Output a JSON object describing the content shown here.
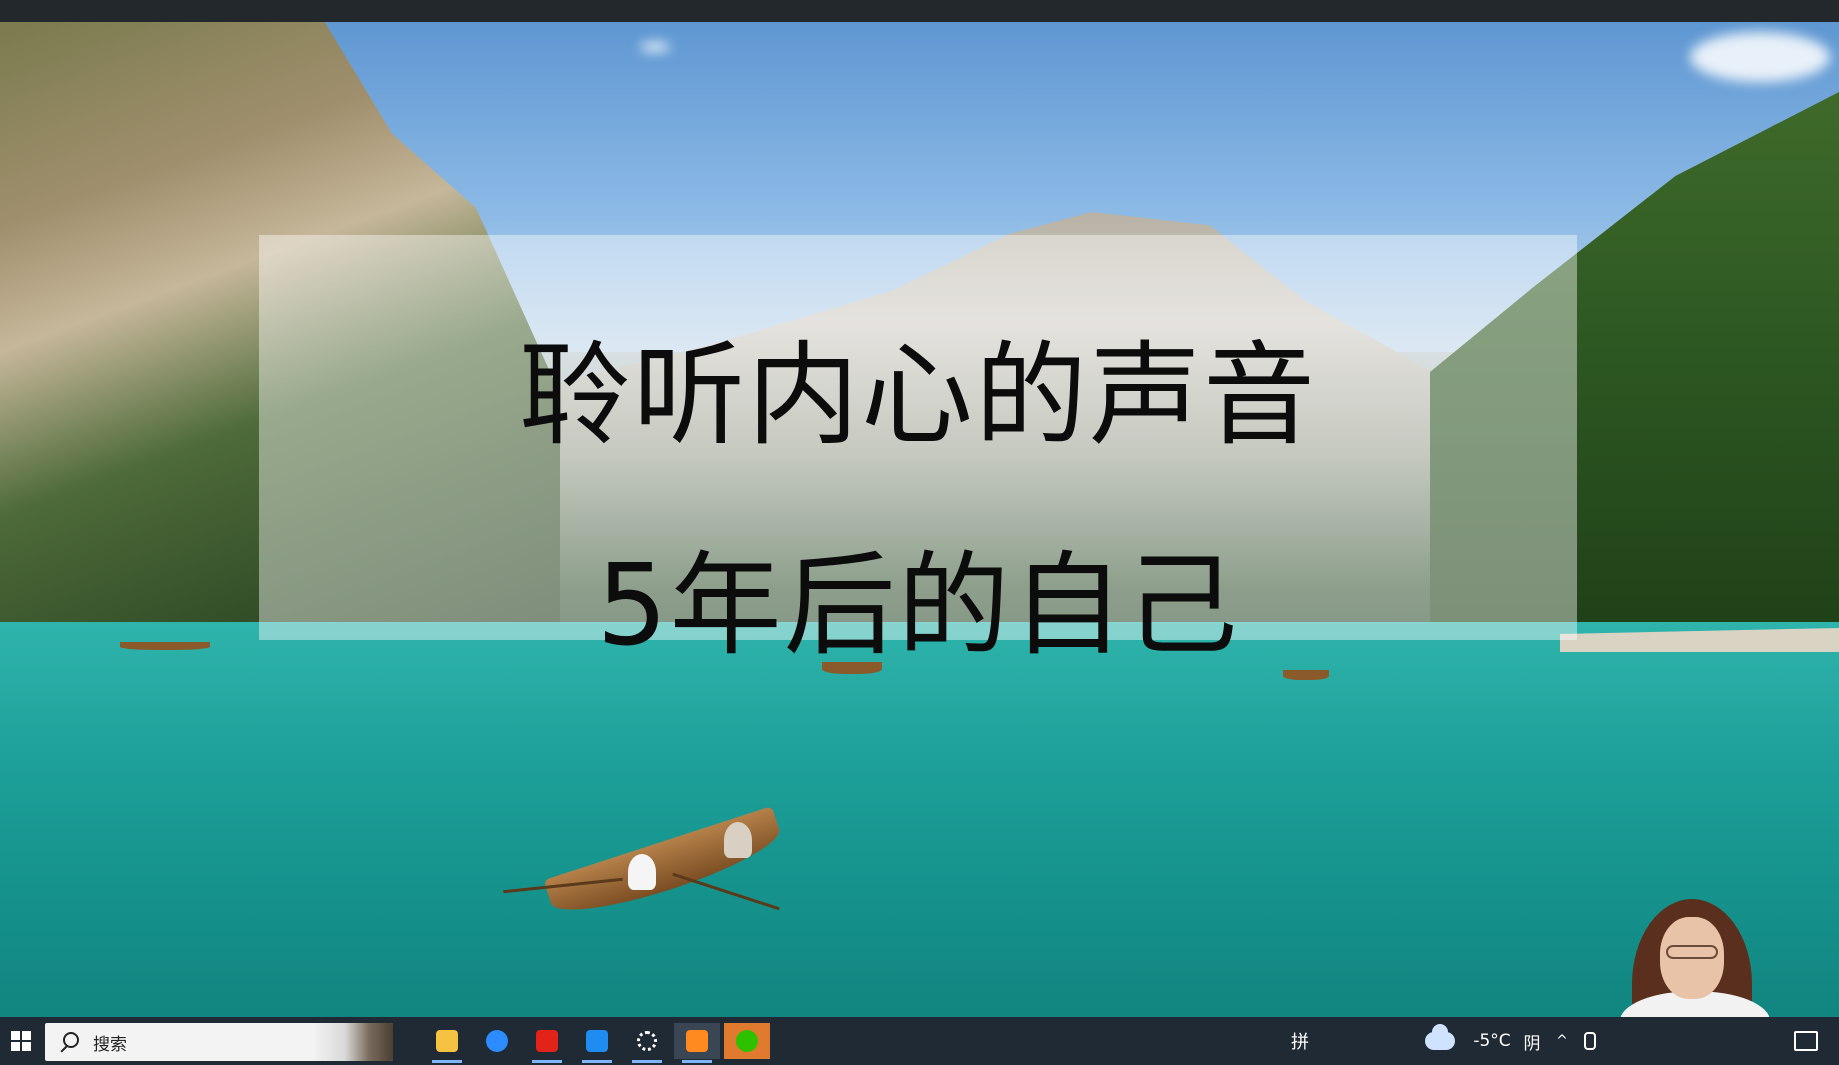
{
  "slide": {
    "title_line1": "聆听内心的声音",
    "title_line2": "5年后的自己"
  },
  "taskbar": {
    "search_placeholder": "搜索",
    "apps": [
      {
        "name": "file-explorer",
        "color": "#f5c242"
      },
      {
        "name": "k-app",
        "color": "#2d8cff"
      },
      {
        "name": "wps",
        "color": "#e2231a"
      },
      {
        "name": "photos",
        "color": "#1e8cf0"
      },
      {
        "name": "settings",
        "color": "#ffffff"
      },
      {
        "name": "media-player",
        "color": "#ff8a1f"
      },
      {
        "name": "wechat",
        "color": "#2dc100"
      }
    ],
    "ime_label": "拼",
    "weather_temp": "-5°C",
    "weather_condition": "阴",
    "tray_chevron": "^"
  }
}
